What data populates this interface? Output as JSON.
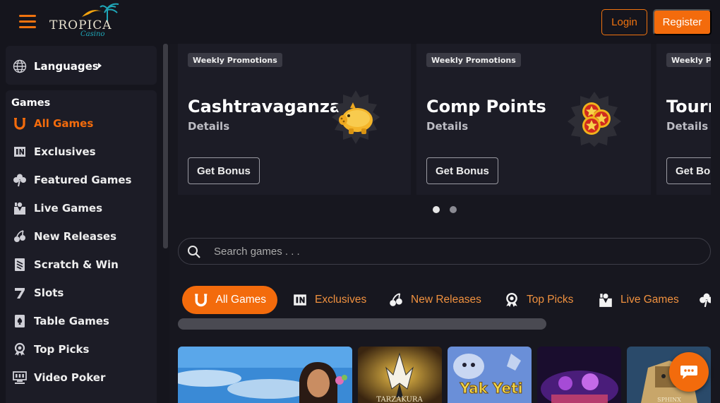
{
  "header": {
    "logo_text": "TROPICA",
    "logo_sub": "Casino",
    "login_label": "Login",
    "register_label": "Register"
  },
  "sidebar": {
    "languages_label": "Languages",
    "games_title": "Games",
    "items": [
      {
        "label": "All Games",
        "icon": "horseshoe-icon",
        "active": true
      },
      {
        "label": "Exclusives",
        "icon": "exclusive-badge-icon",
        "active": false
      },
      {
        "label": "Featured Games",
        "icon": "clover-icon",
        "active": false
      },
      {
        "label": "Live Games",
        "icon": "dealer-icon",
        "active": false
      },
      {
        "label": "New Releases",
        "icon": "cherries-icon",
        "active": false
      },
      {
        "label": "Scratch & Win",
        "icon": "scratch-card-icon",
        "active": false
      },
      {
        "label": "Slots",
        "icon": "seven-icon",
        "active": false
      },
      {
        "label": "Table Games",
        "icon": "card-spade-icon",
        "active": false
      },
      {
        "label": "Top Picks",
        "icon": "award-icon",
        "active": false
      },
      {
        "label": "Video Poker",
        "icon": "video-poker-icon",
        "active": false
      }
    ]
  },
  "promotions": [
    {
      "tag": "Weekly Promotions",
      "title": "Cashtravaganza",
      "details": "Details",
      "button": "Get Bonus",
      "art": "piggy-bank-icon"
    },
    {
      "tag": "Weekly Promotions",
      "title": "Comp Points",
      "details": "Details",
      "button": "Get Bonus",
      "art": "star-coins-icon"
    },
    {
      "tag": "Weekly Promotions",
      "title": "Tourn",
      "details": "Details",
      "button": "Get Bonus",
      "art": ""
    }
  ],
  "search": {
    "placeholder": "Search games . . ."
  },
  "tabs": [
    {
      "label": "All Games",
      "icon": "horseshoe-icon",
      "active": true
    },
    {
      "label": "Exclusives",
      "icon": "exclusive-badge-icon",
      "active": false
    },
    {
      "label": "New Releases",
      "icon": "cherries-icon",
      "active": false
    },
    {
      "label": "Top Picks",
      "icon": "award-icon",
      "active": false
    },
    {
      "label": "Live Games",
      "icon": "dealer-icon",
      "active": false
    }
  ],
  "games": [
    {
      "name": "",
      "image": "tropical-woman-game-thumbnail"
    },
    {
      "name": "TARZAKURA",
      "image": "tarzakura-game-thumbnail"
    },
    {
      "name": "Yak Yeti",
      "image": "yak-yeti-game-thumbnail"
    },
    {
      "name": "",
      "image": "purple-game-thumbnail"
    },
    {
      "name": "SPHINX",
      "image": "sphinx-game-thumbnail"
    }
  ],
  "colors": {
    "accent": "#f36b0c",
    "background": "#17171f",
    "panel": "#1c1c26"
  }
}
